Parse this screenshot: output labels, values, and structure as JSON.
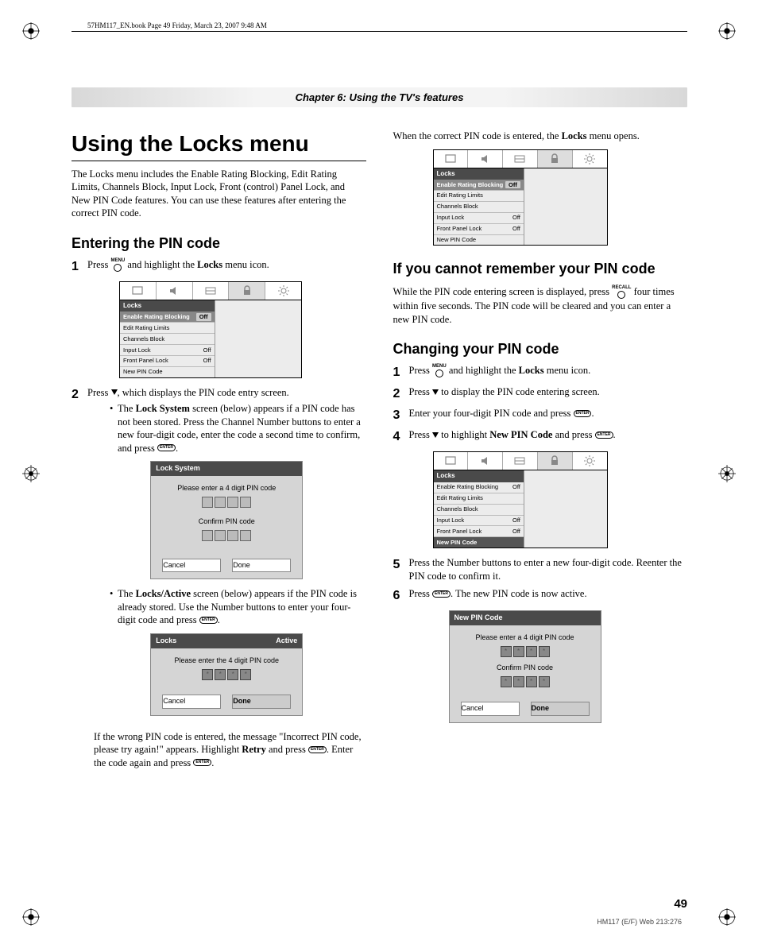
{
  "bookmark": "57HM117_EN.book  Page 49  Friday, March 23, 2007  9:48 AM",
  "chapter": "Chapter 6: Using the TV's features",
  "h1": "Using the Locks menu",
  "intro": "The Locks menu includes the Enable Rating Blocking, Edit Rating Limits, Channels Block, Input Lock, Front (control) Panel Lock, and New PIN Code features. You can use these features after entering the correct PIN code.",
  "h2_enter": "Entering the PIN code",
  "step1": {
    "a": "Press ",
    "key": "MENU",
    "b": " and highlight the ",
    "c": "Locks",
    "d": " menu icon."
  },
  "osd": {
    "hdr": "Locks",
    "rows": [
      {
        "l": "Enable Rating Blocking",
        "v": "Off"
      },
      {
        "l": "Edit Rating Limits",
        "v": ""
      },
      {
        "l": "Channels Block",
        "v": ""
      },
      {
        "l": "Input Lock",
        "v": "Off"
      },
      {
        "l": "Front Panel Lock",
        "v": "Off"
      },
      {
        "l": "New PIN Code",
        "v": ""
      }
    ]
  },
  "step2": {
    "a": "Press ",
    "b": ", which displays the PIN code entry screen."
  },
  "bul1": {
    "a": "The ",
    "b": "Lock System",
    "c": " screen (below) appears if a PIN code has not been stored. Press the Channel Number buttons to enter a new four-digit code, enter the code a second time to confirm, and press ",
    "d": "."
  },
  "pin1": {
    "title": "Lock System",
    "line1": "Please enter a 4 digit PIN code",
    "line2": "Confirm PIN code",
    "cancel": "Cancel",
    "done": "Done"
  },
  "bul2": {
    "a": "The ",
    "b": "Locks/Active",
    "c": " screen (below) appears if the PIN code is already stored. Use the Number buttons to enter your four-digit code and press ",
    "d": "."
  },
  "pin2": {
    "title_l": "Locks",
    "title_r": "Active",
    "line1": "Please enter the 4 digit PIN code",
    "cancel": "Cancel",
    "done": "Done"
  },
  "wrong": {
    "a": "If the wrong PIN code is entered, the message \"Incorrect PIN code, please try again!\" appears. Highlight ",
    "b": "Retry",
    "c": " and press ",
    "d": ". Enter the code again and press ",
    "e": "."
  },
  "right_open": {
    "a": "When the correct PIN code is entered, the ",
    "b": "Locks",
    "c": " menu opens."
  },
  "h2_cannot": "If you cannot remember your PIN code",
  "cannot": {
    "a": "While the PIN code entering screen is displayed, press ",
    "key": "RECALL",
    "b": " four times within five seconds. The PIN code will be cleared and you can enter a new PIN code."
  },
  "h2_change": "Changing your PIN code",
  "cstep1": {
    "a": "Press ",
    "key": "MENU",
    "b": " and highlight the ",
    "c": "Locks",
    "d": " menu icon."
  },
  "cstep2": {
    "a": "Press ",
    "b": " to display the PIN code entering screen."
  },
  "cstep3": {
    "a": "Enter your four-digit PIN code and press ",
    "b": "."
  },
  "cstep4": {
    "a": "Press ",
    "b": " to highlight ",
    "c": "New PIN Code",
    "d": " and press ",
    "e": "."
  },
  "cstep5": "Press the Number buttons to enter a new four-digit code. Reenter the PIN code to confirm it.",
  "cstep6": {
    "a": "Press ",
    "b": ". The new PIN code is now active."
  },
  "pin3": {
    "title": "New PIN Code",
    "line1": "Please enter a 4 digit PIN code",
    "line2": "Confirm PIN code",
    "cancel": "Cancel",
    "done": "Done"
  },
  "pagenum": "49",
  "footer": "HM117 (E/F) Web 213:276",
  "enter": "ENTER"
}
